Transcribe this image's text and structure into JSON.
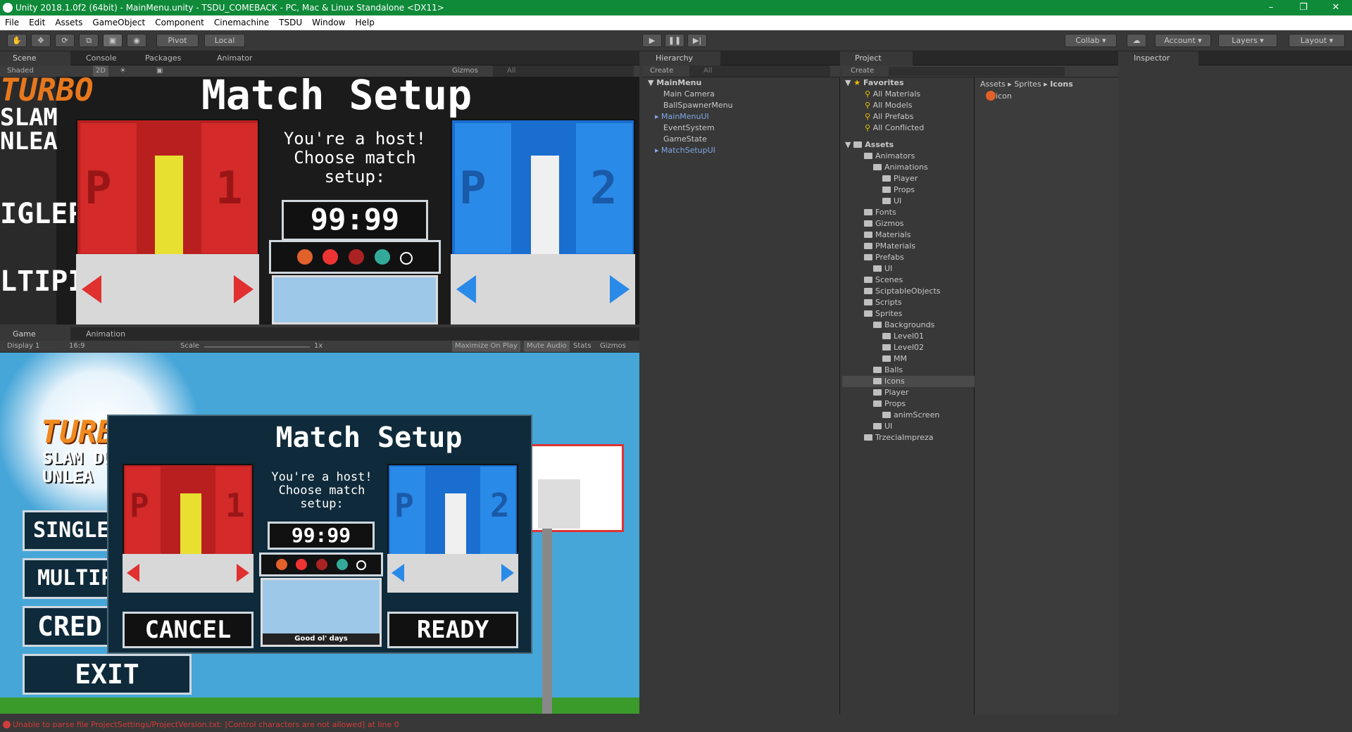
{
  "window": {
    "title": "Unity 2018.1.0f2 (64bit) - MainMenu.unity - TSDU_COMEBACK - PC, Mac & Linux Standalone <DX11>"
  },
  "menu": [
    "File",
    "Edit",
    "Assets",
    "GameObject",
    "Component",
    "Cinemachine",
    "TSDU",
    "Window",
    "Help"
  ],
  "toolbar": {
    "pivot": "Pivot",
    "local": "Local",
    "collab": "Collab",
    "account": "Account",
    "layers": "Layers",
    "layout": "Layout"
  },
  "scene_tabs": {
    "scene": "Scene",
    "console": "Console",
    "packages": "Packages",
    "animator": "Animator"
  },
  "scene_bar": {
    "shaded": "Shaded",
    "mode2d": "2D",
    "gizmos": "Gizmos",
    "search": "All"
  },
  "game_tabs": {
    "game": "Game",
    "animation": "Animation"
  },
  "game_bar": {
    "display": "Display 1",
    "aspect": "16:9",
    "scale": "Scale",
    "scale_value": "1x",
    "maximize": "Maximize On Play",
    "mute": "Mute Audio",
    "stats": "Stats",
    "gizmos": "Gizmos"
  },
  "game": {
    "logo_top": "TURBO",
    "logo_mid": "SLAM DUNK",
    "logo_bot": "UNLEA",
    "title": "Match Setup",
    "host_line1": "You're a host!",
    "host_line2": "Choose match",
    "host_line3": "setup:",
    "timer": "99:99",
    "p1": "P",
    "p1num": "1",
    "p2": "P",
    "p2num": "2",
    "level_label": "Good ol' days",
    "menu_single": "SINGLEP",
    "menu_multi": "MULTIPL",
    "menu_credits": "CRED",
    "menu_exit": "EXIT",
    "cancel": "CANCEL",
    "ready": "READY",
    "scene_single": "IGLEP",
    "scene_multi": "LTIPI",
    "scene_logo": "TURBO",
    "scene_slam": "SLAM",
    "scene_unle": "NLEA"
  },
  "hierarchy": {
    "tab": "Hierarchy",
    "create": "Create",
    "search": "All",
    "scene": "MainMenu",
    "items": [
      {
        "label": "Main Camera",
        "color": "#c8c8c8"
      },
      {
        "label": "BallSpawnerMenu",
        "color": "#c8c8c8"
      },
      {
        "label": "MainMenuUI",
        "color": "#7fa8e6"
      },
      {
        "label": "EventSystem",
        "color": "#c8c8c8"
      },
      {
        "label": "GameState",
        "color": "#c8c8c8"
      },
      {
        "label": "MatchSetupUI",
        "color": "#7fa8e6"
      }
    ]
  },
  "project": {
    "tab": "Project",
    "create": "Create",
    "favorites_label": "Favorites",
    "favorites": [
      "All Materials",
      "All Models",
      "All Prefabs",
      "All Conflicted"
    ],
    "assets_label": "Assets",
    "tree": [
      {
        "label": "Animators",
        "depth": 1
      },
      {
        "label": "Animations",
        "depth": 2
      },
      {
        "label": "Player",
        "depth": 3
      },
      {
        "label": "Props",
        "depth": 3
      },
      {
        "label": "UI",
        "depth": 3
      },
      {
        "label": "Fonts",
        "depth": 1
      },
      {
        "label": "Gizmos",
        "depth": 1
      },
      {
        "label": "Materials",
        "depth": 1
      },
      {
        "label": "PMaterials",
        "depth": 1
      },
      {
        "label": "Prefabs",
        "depth": 1
      },
      {
        "label": "UI",
        "depth": 2
      },
      {
        "label": "Scenes",
        "depth": 1
      },
      {
        "label": "SciptableObjects",
        "depth": 1
      },
      {
        "label": "Scripts",
        "depth": 1
      },
      {
        "label": "Sprites",
        "depth": 1
      },
      {
        "label": "Backgrounds",
        "depth": 2
      },
      {
        "label": "Level01",
        "depth": 3
      },
      {
        "label": "Level02",
        "depth": 3
      },
      {
        "label": "MM",
        "depth": 3
      },
      {
        "label": "Balls",
        "depth": 2
      },
      {
        "label": "Icons",
        "depth": 2
      },
      {
        "label": "Player",
        "depth": 2
      },
      {
        "label": "Props",
        "depth": 2
      },
      {
        "label": "animScreen",
        "depth": 3
      },
      {
        "label": "UI",
        "depth": 2
      },
      {
        "label": "TrzeciaImpreza",
        "depth": 1
      }
    ],
    "breadcrumb": [
      "Assets",
      "Sprites",
      "Icons"
    ],
    "file": "icon"
  },
  "inspector": {
    "tab": "Inspector"
  },
  "status": {
    "error": "Unable to parse file ProjectSettings/ProjectVersion.txt: [Control characters are not allowed] at line 0"
  }
}
